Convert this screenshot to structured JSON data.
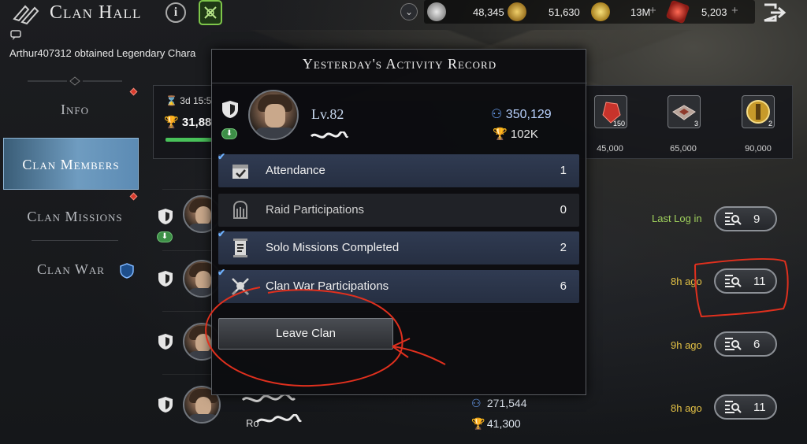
{
  "header": {
    "title": "Clan Hall",
    "info_label": "i"
  },
  "resources": [
    {
      "icon": "silver-coin-icon",
      "value": "48,345",
      "color": "#b8b8b8"
    },
    {
      "icon": "gold-coin-icon",
      "value": "51,630",
      "color": "#c89a2c"
    },
    {
      "icon": "gold-medal-icon",
      "value": "13M",
      "color": "#d8b03a",
      "plus": "+"
    },
    {
      "icon": "red-crystal-icon",
      "value": "5,203",
      "color": "#c8332b",
      "plus": "+"
    }
  ],
  "chat": {
    "message": "Arthur407312 obtained Legendary Chara"
  },
  "sidebar": {
    "items": [
      {
        "label": "Info"
      },
      {
        "label": "Clan Members"
      },
      {
        "label": "Clan Missions"
      },
      {
        "label": "Clan War"
      }
    ]
  },
  "reward_strip": {
    "timer": "3d 15:5",
    "trophy_total": "31,88",
    "rewards": [
      {
        "icon": "red-gem-icon",
        "count": "150",
        "cost": "45,000"
      },
      {
        "icon": "crate-icon",
        "count": "3",
        "cost": "65,000"
      },
      {
        "icon": "gold-shield-icon",
        "count": "2",
        "cost": "90,000"
      }
    ]
  },
  "members": [
    {
      "last_log": "Last Log in",
      "views": "9"
    },
    {
      "last_log": "8h ago",
      "views": "11"
    },
    {
      "last_log": "9h ago",
      "views": "6"
    },
    {
      "last_log": "8h ago",
      "views": "11",
      "power": "271,544",
      "trophies": "41,300",
      "name": "Ro"
    }
  ],
  "modal": {
    "title": "Yesterday's Activity Record",
    "level": "Lv.82",
    "power": "350,129",
    "trophies": "102K",
    "activities": [
      {
        "label": "Attendance",
        "value": "1",
        "checked": true
      },
      {
        "label": "Raid Participations",
        "value": "0",
        "checked": false
      },
      {
        "label": "Solo Missions Completed",
        "value": "2",
        "checked": true
      },
      {
        "label": "Clan War Participations",
        "value": "6",
        "checked": true
      }
    ],
    "leave_button": "Leave Clan"
  },
  "colors": {
    "accent_blue": "#6f9cc0",
    "last_log_green": "#9fd05c",
    "last_log_yellow": "#e2c045",
    "annotation_red": "#e0301e"
  }
}
